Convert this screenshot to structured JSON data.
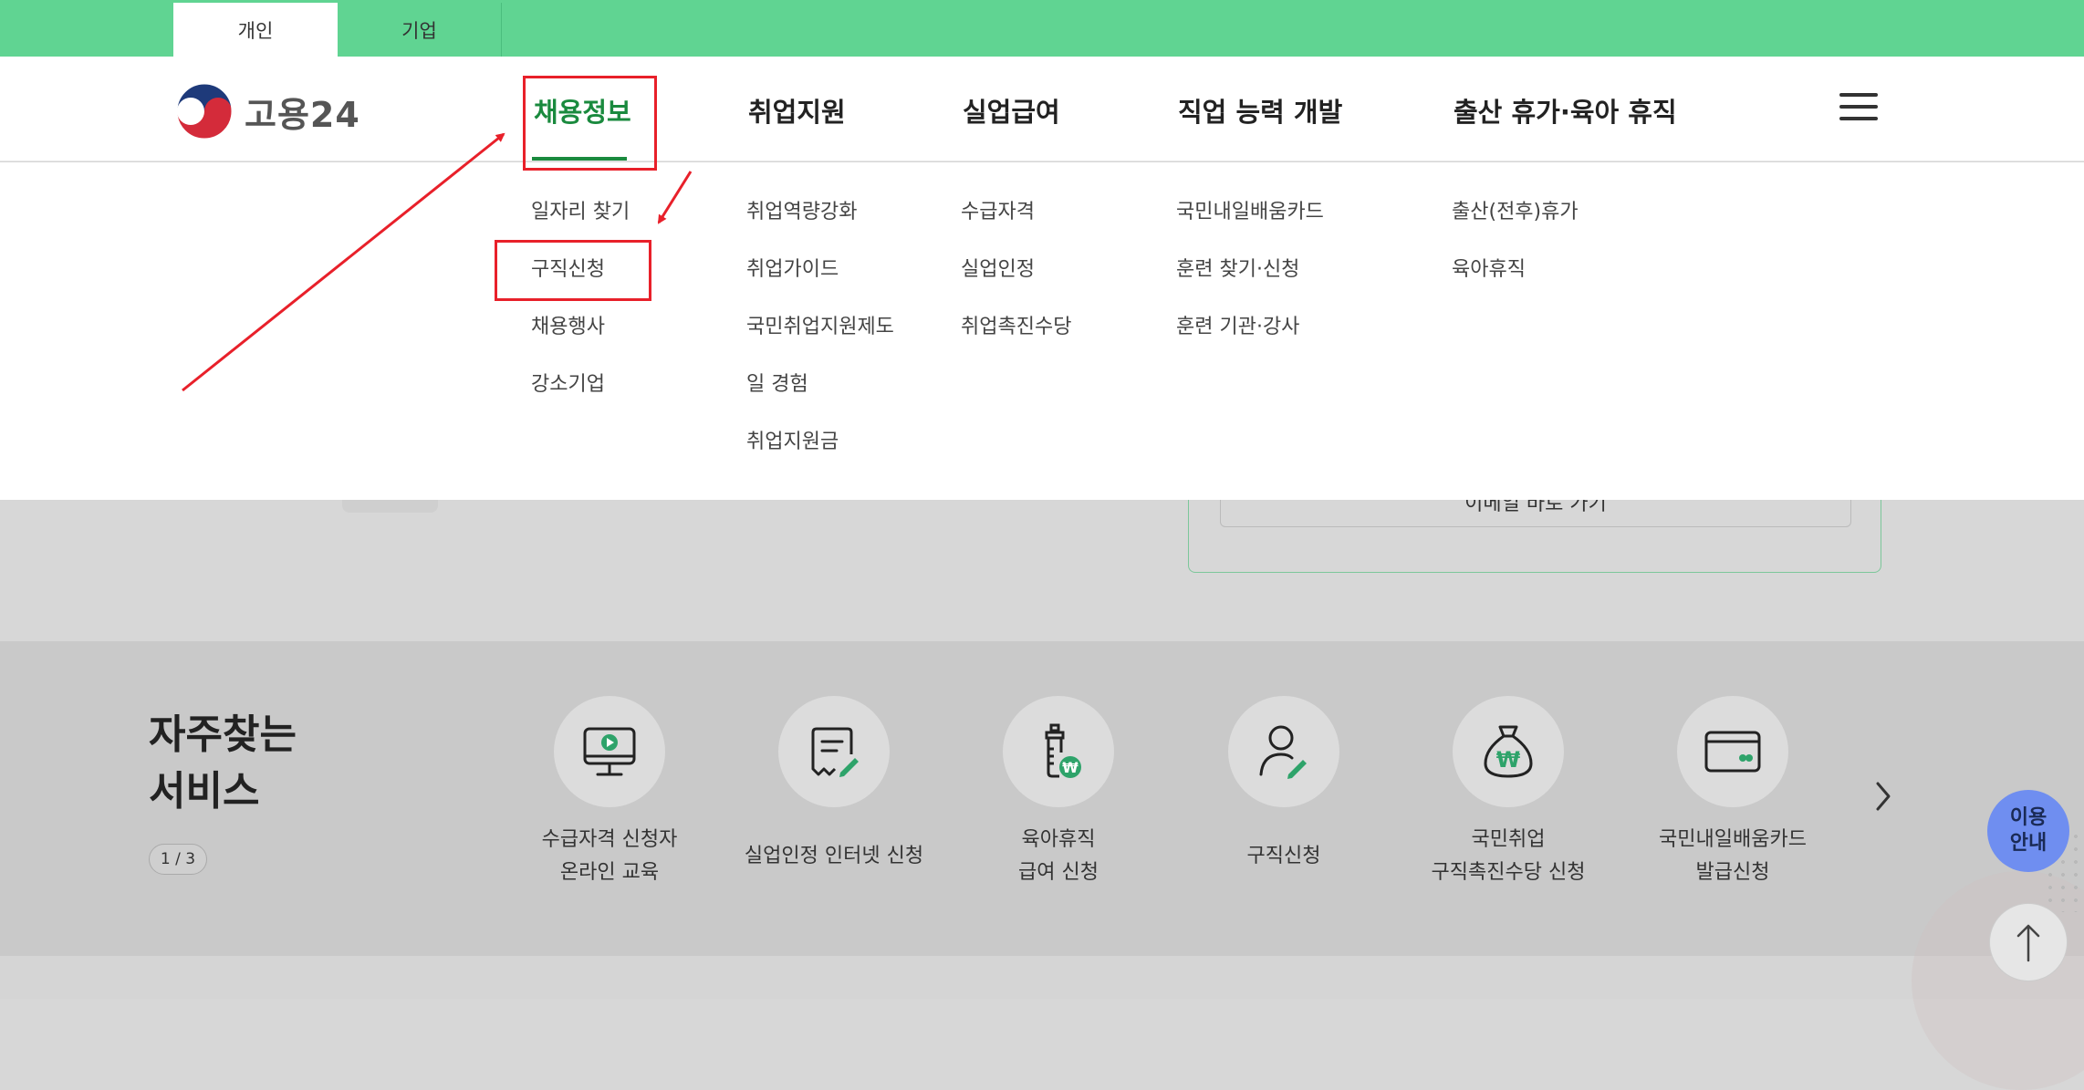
{
  "top_tabs": {
    "personal": "개인",
    "business": "기업"
  },
  "logo": {
    "text": "고용24"
  },
  "gnb": [
    {
      "label": "채용정보"
    },
    {
      "label": "취업지원"
    },
    {
      "label": "실업급여"
    },
    {
      "label": "직업 능력 개발"
    },
    {
      "label": "출산 휴가·육아 휴직"
    }
  ],
  "dropdown": {
    "col1": [
      "일자리 찾기",
      "구직신청",
      "채용행사",
      "강소기업"
    ],
    "col2": [
      "취업역량강화",
      "취업가이드",
      "국민취업지원제도",
      "일 경험",
      "취업지원금"
    ],
    "col3": [
      "수급자격",
      "실업인정",
      "취업촉진수당"
    ],
    "col4": [
      "국민내일배움카드",
      "훈련 찾기·신청",
      "훈련 기관·강사"
    ],
    "col5": [
      "출산(전후)휴가",
      "육아휴직"
    ]
  },
  "background": {
    "partial_button_text": "이메일 바로 가기"
  },
  "services": {
    "title_line1": "자주찾는",
    "title_line2": "서비스",
    "pager": "1 / 3",
    "items": [
      {
        "icon": "monitor-play-icon",
        "line1": "수급자격 신청자",
        "line2": "온라인 교육"
      },
      {
        "icon": "document-pen-icon",
        "line1": "실업인정 인터넷 신청",
        "line2": ""
      },
      {
        "icon": "baby-bottle-won-icon",
        "line1": "육아휴직",
        "line2": "급여 신청"
      },
      {
        "icon": "person-pen-icon",
        "line1": "구직신청",
        "line2": ""
      },
      {
        "icon": "money-bag-won-icon",
        "line1": "국민취업",
        "line2": "구직촉진수당 신청"
      },
      {
        "icon": "card-icon",
        "line1": "국민내일배움카드",
        "line2": "발급신청"
      }
    ]
  },
  "floating": {
    "guide_line1": "이용",
    "guide_line2": "안내"
  },
  "colors": {
    "green_bar": "#60d492",
    "active_green": "#1a8a3e",
    "annotation_red": "#e8202a",
    "guide_blue": "#6f8ef0",
    "icon_green": "#2ea36a"
  }
}
